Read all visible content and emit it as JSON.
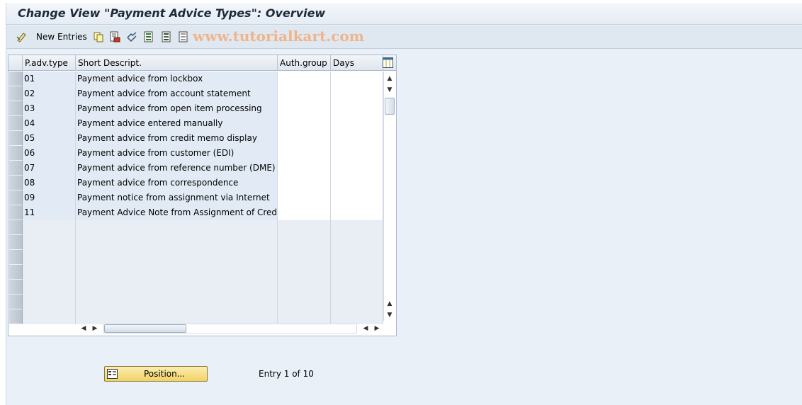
{
  "window": {
    "title": "Change View \"Payment Advice Types\": Overview"
  },
  "toolbar": {
    "new_entries_label": "New Entries",
    "watermark": "www.tutorialkart.com",
    "icons": [
      "display-change-icon",
      "copy-icon",
      "delete-icon",
      "undo-icon",
      "select-all-icon",
      "select-block-icon",
      "deselect-all-icon"
    ]
  },
  "table": {
    "columns": [
      "P.adv.type",
      "Short Descript.",
      "Auth.group",
      "Days"
    ],
    "rows": [
      {
        "type": "01",
        "desc": "Payment advice from lockbox",
        "auth": "",
        "days": ""
      },
      {
        "type": "02",
        "desc": "Payment advice from account statement",
        "auth": "",
        "days": ""
      },
      {
        "type": "03",
        "desc": "Payment advice from open item processing",
        "auth": "",
        "days": ""
      },
      {
        "type": "04",
        "desc": "Payment advice entered manually",
        "auth": "",
        "days": ""
      },
      {
        "type": "05",
        "desc": "Payment advice from credit memo display",
        "auth": "",
        "days": ""
      },
      {
        "type": "06",
        "desc": "Payment advice from customer (EDI)",
        "auth": "",
        "days": ""
      },
      {
        "type": "07",
        "desc": "Payment advice from reference number (DME)",
        "auth": "",
        "days": ""
      },
      {
        "type": "08",
        "desc": "Payment advice from correspondence",
        "auth": "",
        "days": ""
      },
      {
        "type": "09",
        "desc": "Payment notice from assignment via Internet",
        "auth": "",
        "days": ""
      },
      {
        "type": "11",
        "desc": "Payment Advice Note from Assignment of Credits/…",
        "auth": "",
        "days": ""
      }
    ],
    "empty_rows": 7
  },
  "footer": {
    "position_button_label": "Position...",
    "entry_text": "Entry 1 of 10"
  },
  "colors": {
    "background": "#eaf0f7",
    "toolbar": "#dfe8f1",
    "key_cell": "#e2ebf5",
    "button": "#f2d266",
    "watermark": "#f0b48a"
  }
}
